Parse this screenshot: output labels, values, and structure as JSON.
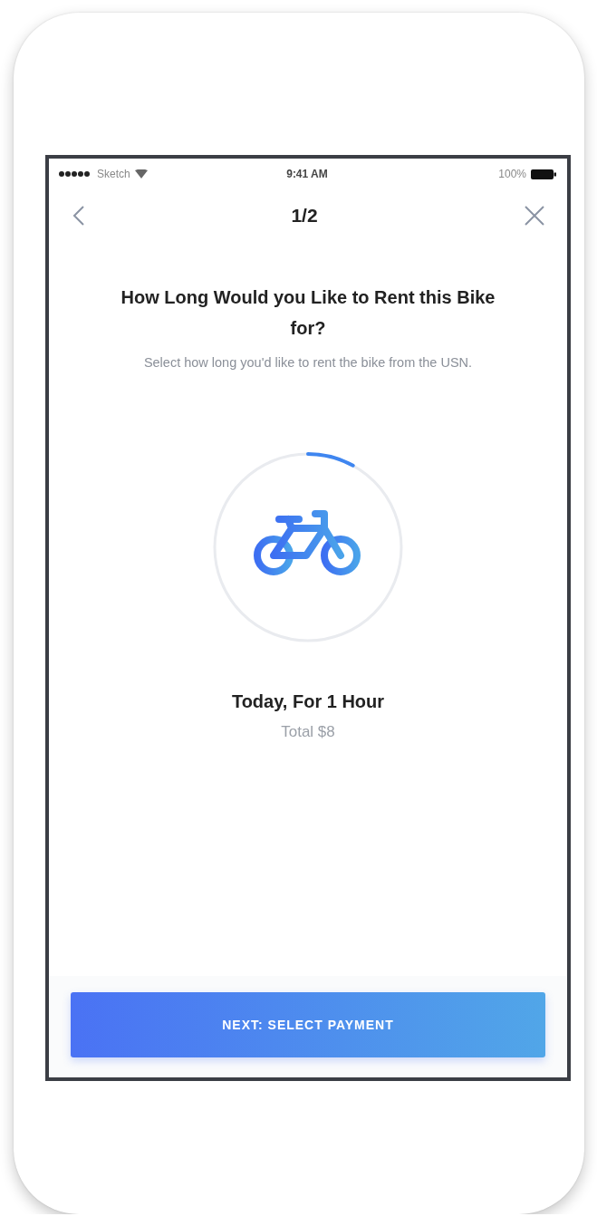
{
  "status_bar": {
    "carrier": "Sketch",
    "time": "9:41 AM",
    "battery": "100%"
  },
  "nav": {
    "title": "1/2"
  },
  "heading": "How Long Would you Like to Rent this Bike for?",
  "subtitle": "Select how long you'd like to rent the bike from the USN.",
  "progress": {
    "level": 0.08
  },
  "summary": {
    "title": "Today, For 1 Hour",
    "total": "Total $8"
  },
  "button": {
    "label": "NEXT: SELECT PAYMENT"
  }
}
